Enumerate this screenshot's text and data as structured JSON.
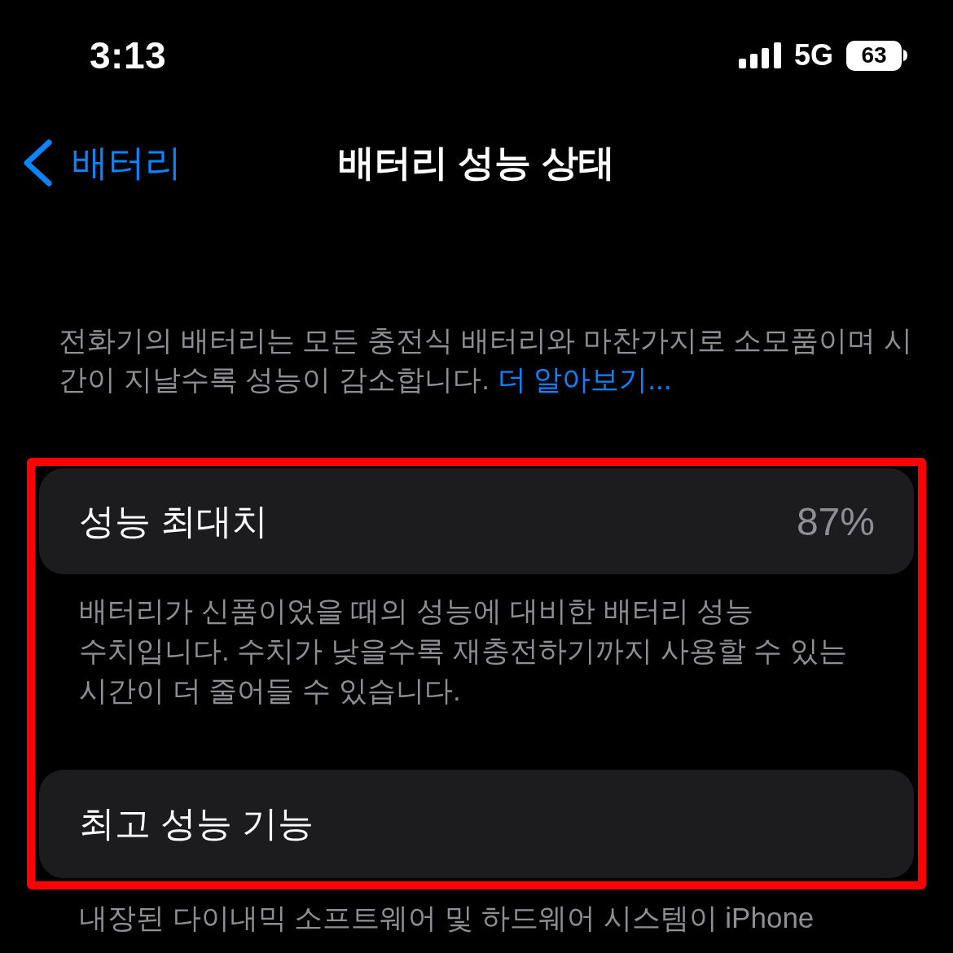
{
  "status_bar": {
    "time": "3:13",
    "network": "5G",
    "battery": "63"
  },
  "nav_bar": {
    "back_label": "배터리",
    "title": "배터리 성능 상태"
  },
  "intro": {
    "lines": [
      "전화기의 배터리는 모든 충전식 배터리와 마찬가지로 소모품이며 시",
      "간이 지날수록 성능이 감소합니다."
    ],
    "link": "더 알아보기..."
  },
  "highlighted": true,
  "sections": [
    {
      "label": "성능 최대치",
      "value": "87%",
      "footer": [
        "배터리가 신품이었을 때의 성능에 대비한 배터리 성능",
        "수치입니다. 수치가 낮을수록 재충전하기까지 사용할 수 있는",
        "시간이 더 줄어들 수 있습니다."
      ]
    },
    {
      "label": "최고 성능 기능",
      "footer": [
        "내장된 다이내믹 소프트웨어 및 하드웨어 시스템이 iPhone"
      ]
    }
  ]
}
